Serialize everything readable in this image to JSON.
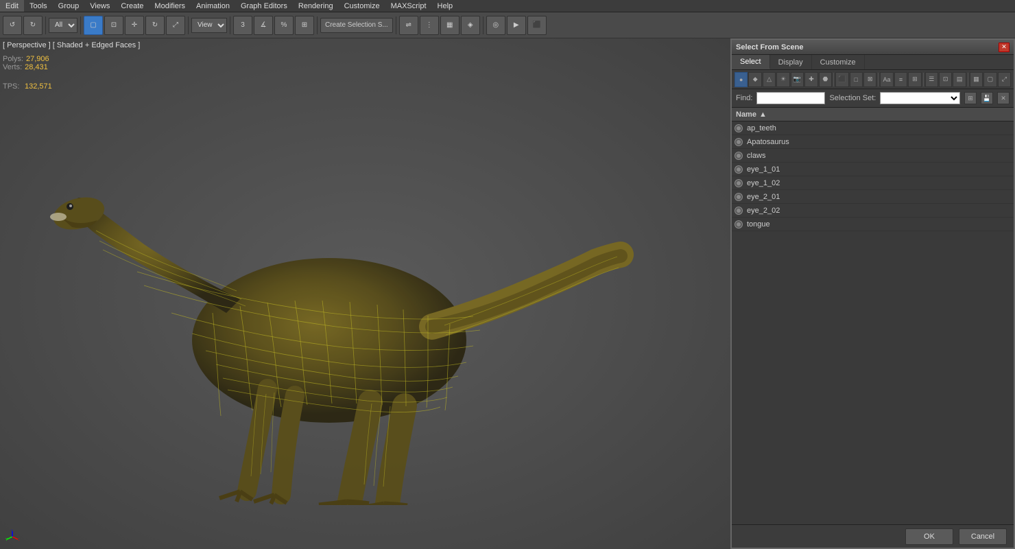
{
  "menubar": {
    "items": [
      "Edit",
      "Tools",
      "Group",
      "Views",
      "Create",
      "Modifiers",
      "Animation",
      "Graph Editors",
      "Rendering",
      "Customize",
      "MAXScript",
      "Help"
    ]
  },
  "toolbar": {
    "mode_select": "All",
    "view_label": "View",
    "create_selection_btn": "Create Selection S..."
  },
  "viewport": {
    "label": "[ Perspective ] [ Shaded + Edged Faces ]",
    "stats": {
      "polys_label": "Polys:",
      "polys_value": "27,906",
      "verts_label": "Verts:",
      "verts_value": "28,431",
      "tris_label": "TPS:",
      "tris_value": "132,571"
    }
  },
  "dialog": {
    "title": "Select From Scene",
    "close_btn": "✕",
    "tabs": [
      "Select",
      "Display",
      "Customize"
    ],
    "active_tab": "Select",
    "find_label": "Find:",
    "find_placeholder": "",
    "selection_set_label": "Selection Set:",
    "selection_set_placeholder": "",
    "list_header": "Name",
    "objects": [
      {
        "name": "ap_teeth"
      },
      {
        "name": "Apatosaurus"
      },
      {
        "name": "claws"
      },
      {
        "name": "eye_1_01"
      },
      {
        "name": "eye_1_02"
      },
      {
        "name": "eye_2_01"
      },
      {
        "name": "eye_2_02"
      },
      {
        "name": "tongue"
      }
    ],
    "ok_btn": "OK",
    "cancel_btn": "Cancel"
  },
  "colors": {
    "accent": "#3a7bc8",
    "stat_value": "#f0c040",
    "viewport_bg_start": "#5a5a5a",
    "viewport_bg_end": "#404040"
  }
}
